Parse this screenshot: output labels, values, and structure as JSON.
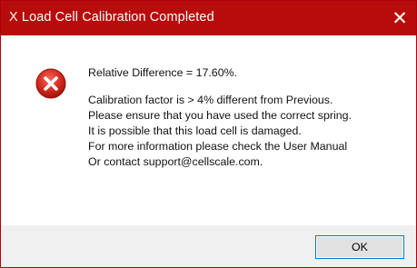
{
  "window": {
    "title": "X Load Cell Calibration Completed",
    "close_glyph": "✕",
    "accent_color": "#b80b0b"
  },
  "message": {
    "icon": "error-icon",
    "relative_difference": "Relative Difference = 17.60%.",
    "lines": [
      "Calibration factor is > 4% different from Previous.",
      "Please ensure that you have used the correct spring.",
      "It is possible that this load cell is damaged.",
      "For more information please check the User Manual",
      "Or contact support@cellscale.com."
    ]
  },
  "buttons": {
    "ok_label": "OK"
  }
}
